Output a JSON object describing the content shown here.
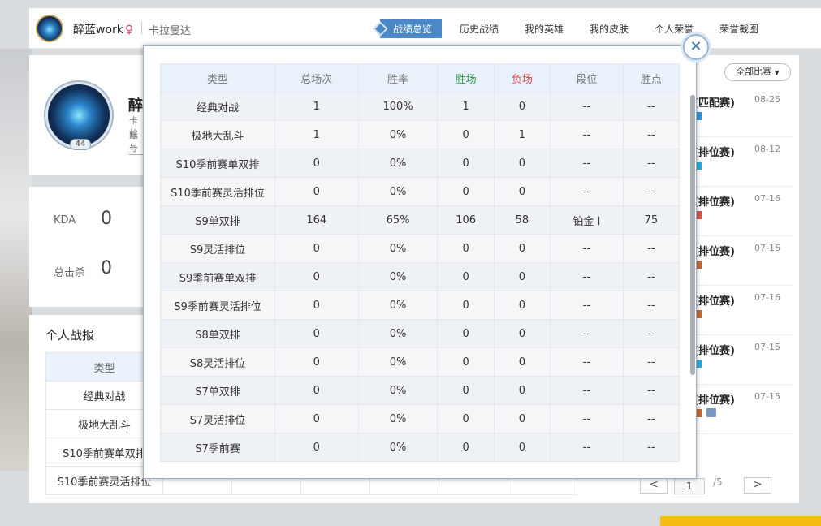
{
  "header": {
    "username": "醉蓝work",
    "gender_icon": "female-icon",
    "server": "卡拉曼达",
    "nav": [
      {
        "label": "战绩总览",
        "active": true
      },
      {
        "label": "历史战绩"
      },
      {
        "label": "我的英雄"
      },
      {
        "label": "我的皮肤"
      },
      {
        "label": "个人荣誉"
      },
      {
        "label": "荣誉截图"
      }
    ]
  },
  "profile": {
    "name_peek": "醉",
    "sub1_peek": "卡拉",
    "sub2_peek": "账号",
    "level": "44"
  },
  "stats": {
    "kda_label": "KDA",
    "kda_value": "0",
    "kills_label": "总击杀",
    "kills_value": "0"
  },
  "report": {
    "title": "个人战报",
    "header": "类型",
    "rows": [
      "经典对战",
      "极地大乱斗",
      "S10季前赛单双排",
      "S10季前赛灵活排位"
    ]
  },
  "matches": {
    "filter_label": "全部比赛",
    "items": [
      {
        "mode": "(匹配赛)",
        "date": "08-25",
        "tag_color": "#3a8fd6"
      },
      {
        "mode": "(排位赛)",
        "date": "08-12",
        "tag_color": "#2eaad6"
      },
      {
        "mode": "(排位赛)",
        "date": "07-16",
        "tag_color": "#d9534f"
      },
      {
        "mode": "(排位赛)",
        "date": "07-16",
        "tag_color": "#c06a3b"
      },
      {
        "mode": "(排位赛)",
        "date": "07-16",
        "tag_color": "#c06a3b"
      },
      {
        "mode": "(排位赛)",
        "date": "07-15",
        "tag_color": "#2eaad6"
      },
      {
        "mode": "(排位赛)",
        "date": "07-15",
        "tag_color": "#c06a3b"
      }
    ],
    "pager": {
      "prev": "<",
      "page": "1",
      "total": "/5",
      "next": ">"
    }
  },
  "modal": {
    "columns": [
      "类型",
      "总场次",
      "胜率",
      "胜场",
      "负场",
      "段位",
      "胜点"
    ],
    "rows": [
      [
        "经典对战",
        "1",
        "100%",
        "1",
        "0",
        "--",
        "--"
      ],
      [
        "极地大乱斗",
        "1",
        "0%",
        "0",
        "1",
        "--",
        "--"
      ],
      [
        "S10季前赛单双排",
        "0",
        "0%",
        "0",
        "0",
        "--",
        "--"
      ],
      [
        "S10季前赛灵活排位",
        "0",
        "0%",
        "0",
        "0",
        "--",
        "--"
      ],
      [
        "S9单双排",
        "164",
        "65%",
        "106",
        "58",
        "铂金 Ⅰ",
        "75"
      ],
      [
        "S9灵活排位",
        "0",
        "0%",
        "0",
        "0",
        "--",
        "--"
      ],
      [
        "S9季前赛单双排",
        "0",
        "0%",
        "0",
        "0",
        "--",
        "--"
      ],
      [
        "S9季前赛灵活排位",
        "0",
        "0%",
        "0",
        "0",
        "--",
        "--"
      ],
      [
        "S8单双排",
        "0",
        "0%",
        "0",
        "0",
        "--",
        "--"
      ],
      [
        "S8灵活排位",
        "0",
        "0%",
        "0",
        "0",
        "--",
        "--"
      ],
      [
        "S7单双排",
        "0",
        "0%",
        "0",
        "0",
        "--",
        "--"
      ],
      [
        "S7灵活排位",
        "0",
        "0%",
        "0",
        "0",
        "--",
        "--"
      ],
      [
        "S7季前赛",
        "0",
        "0%",
        "0",
        "0",
        "--",
        "--"
      ]
    ],
    "close_label": "×"
  }
}
